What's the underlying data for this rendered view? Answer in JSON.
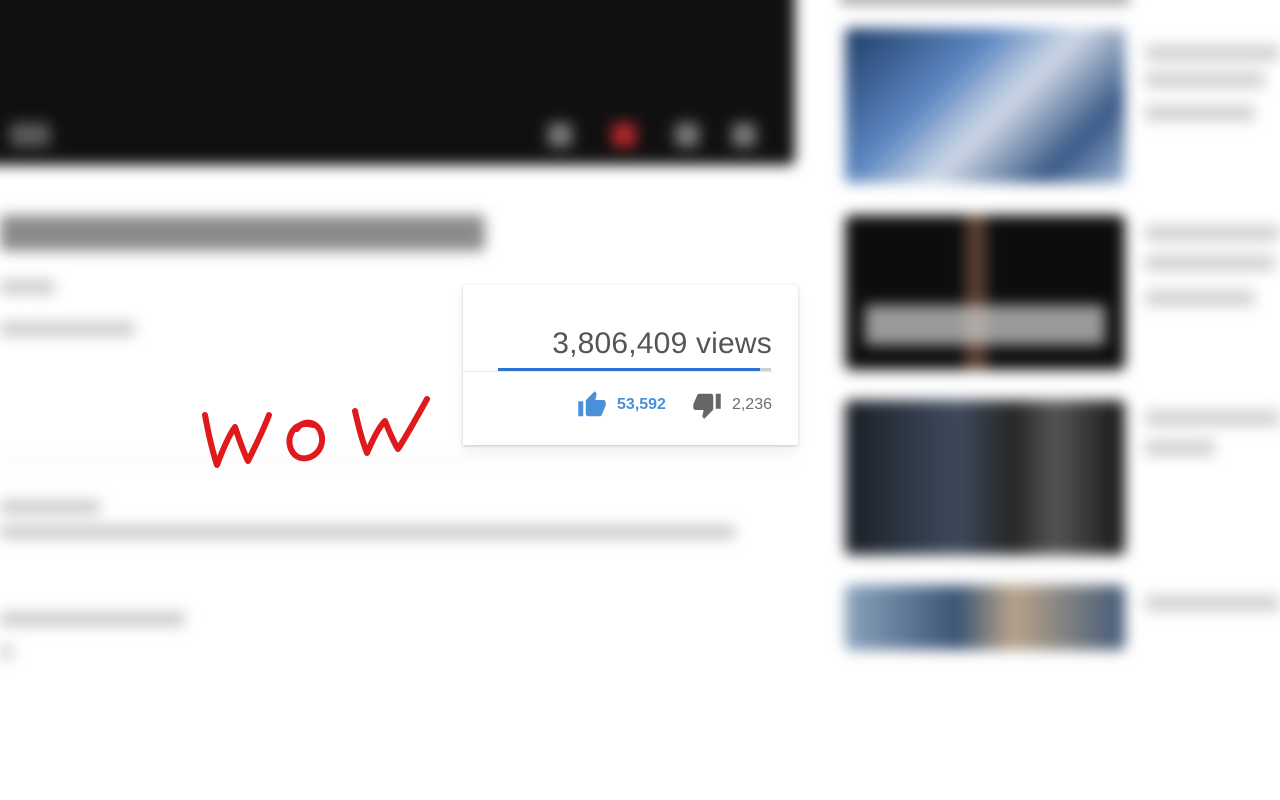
{
  "stats": {
    "views_text": "3,806,409 views",
    "likes": "53,592",
    "dislikes": "2,236",
    "like_ratio": 0.96
  },
  "annotation": {
    "text": "wow",
    "color": "#e0191c"
  },
  "icons": {
    "like": "thumbs-up-icon",
    "dislike": "thumbs-down-icon"
  },
  "colors": {
    "accent": "#2b73d2",
    "like_text": "#4a90d9",
    "annotation": "#e0191c"
  }
}
